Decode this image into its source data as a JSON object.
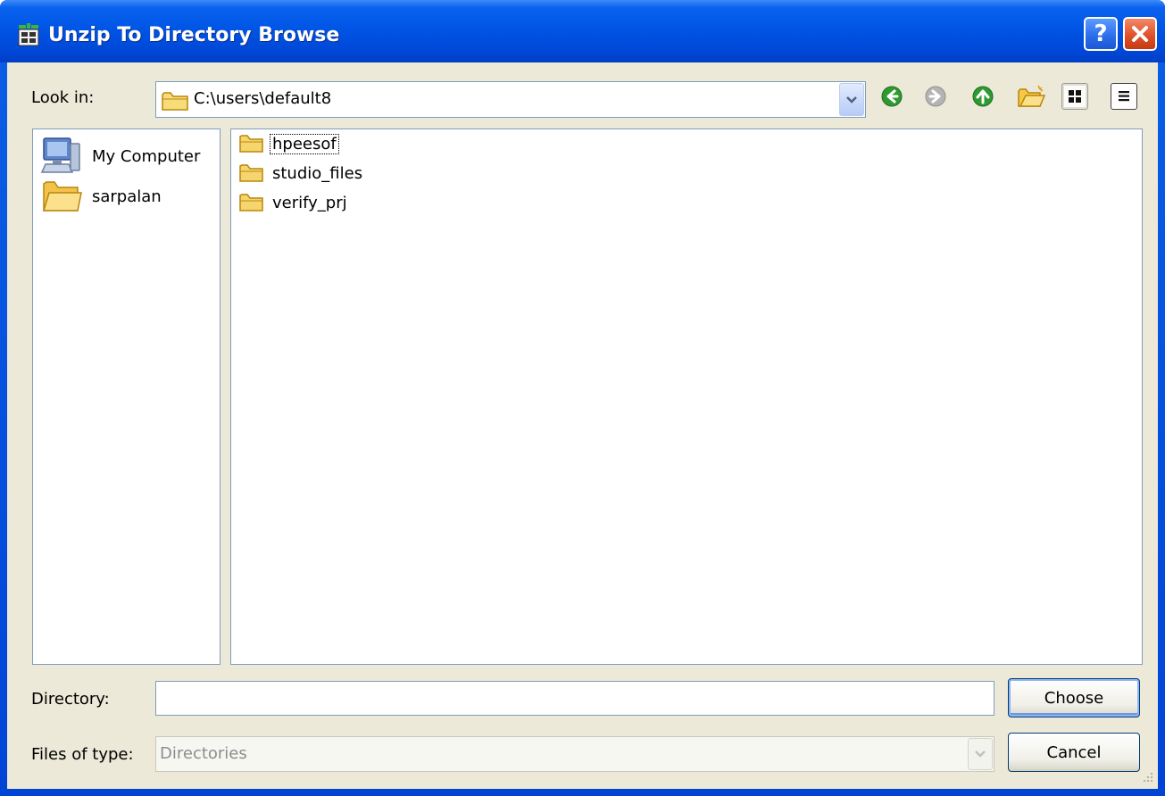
{
  "window": {
    "title": "Unzip To Directory Browse",
    "help_label": "?",
    "close_label": "✕"
  },
  "toolbar": {
    "look_in_label": "Look in:",
    "look_in_value": "C:\\users\\default8",
    "icons": [
      "back-icon",
      "forward-icon",
      "up-folder-icon",
      "new-folder-icon",
      "list-view-icon",
      "details-view-icon"
    ]
  },
  "sidebar": {
    "items": [
      {
        "label": "My Computer",
        "icon": "computer-icon"
      },
      {
        "label": "sarpalan",
        "icon": "folder-icon"
      }
    ]
  },
  "files": {
    "items": [
      {
        "label": "hpeesof",
        "icon": "folder-icon",
        "focused": true
      },
      {
        "label": "studio_files",
        "icon": "folder-icon"
      },
      {
        "label": "verify_prj",
        "icon": "folder-icon"
      }
    ]
  },
  "form": {
    "directory_label": "Directory:",
    "directory_value": "",
    "files_of_type_label": "Files of type:",
    "files_of_type_value": "Directories"
  },
  "buttons": {
    "choose_label": "Choose",
    "cancel_label": "Cancel"
  },
  "colors": {
    "titlebar": "#0055e5",
    "client_bg": "#ece9d8",
    "close": "#e0512a",
    "nav_green": "#2f9a2f"
  }
}
